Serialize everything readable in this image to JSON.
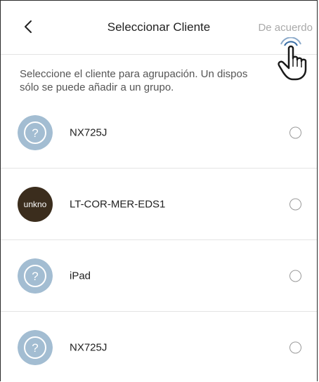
{
  "header": {
    "title": "Seleccionar Cliente",
    "confirm_label": "De acuerdo",
    "back_icon": "chevron-left-icon"
  },
  "description": {
    "line1": "Seleccione el cliente para agrupación. Un dispos",
    "line2": "sólo se puede añadir a un grupo."
  },
  "clients": [
    {
      "name": "NX725J",
      "avatar_type": "unknown-device-icon",
      "selected": false
    },
    {
      "name": "LT-COR-MER-EDS1",
      "avatar_type": "text",
      "avatar_text": "unkno",
      "selected": false
    },
    {
      "name": "iPad",
      "avatar_type": "unknown-device-icon",
      "selected": false
    },
    {
      "name": "NX725J",
      "avatar_type": "unknown-device-icon",
      "selected": false
    }
  ],
  "colors": {
    "avatar_fill": "#a3bdd2",
    "text_avatar_fill": "#3b2d1d",
    "confirm_text": "#a9a9a9",
    "divider": "#e4e4e4"
  }
}
